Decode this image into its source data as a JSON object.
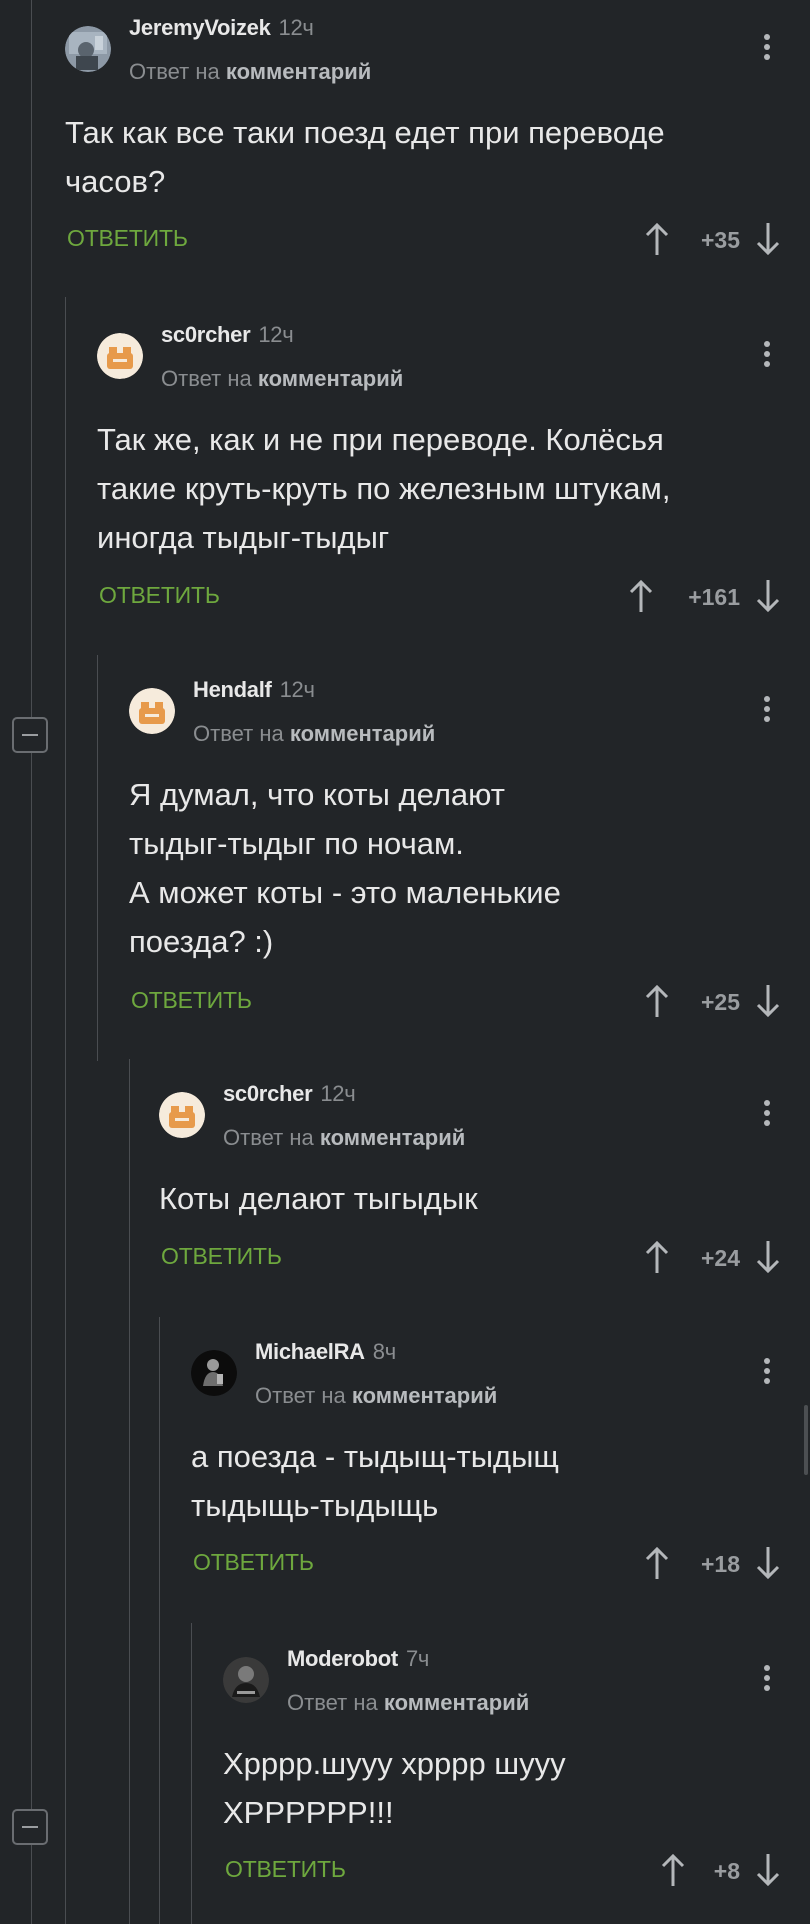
{
  "comments": [
    {
      "username": "JeremyVoizek",
      "time": "12ч",
      "reply_prefix": "Ответ на",
      "reply_target": "комментарий",
      "text": "Так как все таки поезд едет при переводе\nчасов?",
      "reply_label": "ОТВЕТИТЬ",
      "score": "+35"
    },
    {
      "username": "sc0rcher",
      "time": "12ч",
      "reply_prefix": "Ответ на",
      "reply_target": "комментарий",
      "text": "Так же, как и не при переводе. Колёсья\nтакие круть-круть по железным штукам,\nиногда тыдыг-тыдыг",
      "reply_label": "ОТВЕТИТЬ",
      "score": "+161"
    },
    {
      "username": "Hendalf",
      "time": "12ч",
      "reply_prefix": "Ответ на",
      "reply_target": "комментарий",
      "text": "Я думал, что коты делают\nтыдыг-тыдыг по ночам.\nА может коты - это маленькие\nпоезда? :)",
      "reply_label": "ОТВЕТИТЬ",
      "score": "+25"
    },
    {
      "username": "sc0rcher",
      "time": "12ч",
      "reply_prefix": "Ответ на",
      "reply_target": "комментарий",
      "text": "Коты делают тыгыдык",
      "reply_label": "ОТВЕТИТЬ",
      "score": "+24"
    },
    {
      "username": "MichaelRA",
      "time": "8ч",
      "reply_prefix": "Ответ на",
      "reply_target": "комментарий",
      "text": "а поезда - тыдыщ-тыдыщ\nтыдыщь-тыдыщь",
      "reply_label": "ОТВЕТИТЬ",
      "score": "+18"
    },
    {
      "username": "Moderobot",
      "time": "7ч",
      "reply_prefix": "Ответ на",
      "reply_target": "комментарий",
      "text": "Хрррр.шууу хрррр шууу\nХРРРРРР!!!",
      "reply_label": "ОТВЕТИТЬ",
      "score": "+8"
    }
  ],
  "icons": {
    "upvote": "arrow-up-icon",
    "downvote": "arrow-down-icon",
    "more": "more-vertical-icon",
    "collapse": "minus-icon"
  },
  "colors": {
    "background": "#222528",
    "reply_green": "#6ea83e",
    "thread_line": "#4a4d51"
  }
}
